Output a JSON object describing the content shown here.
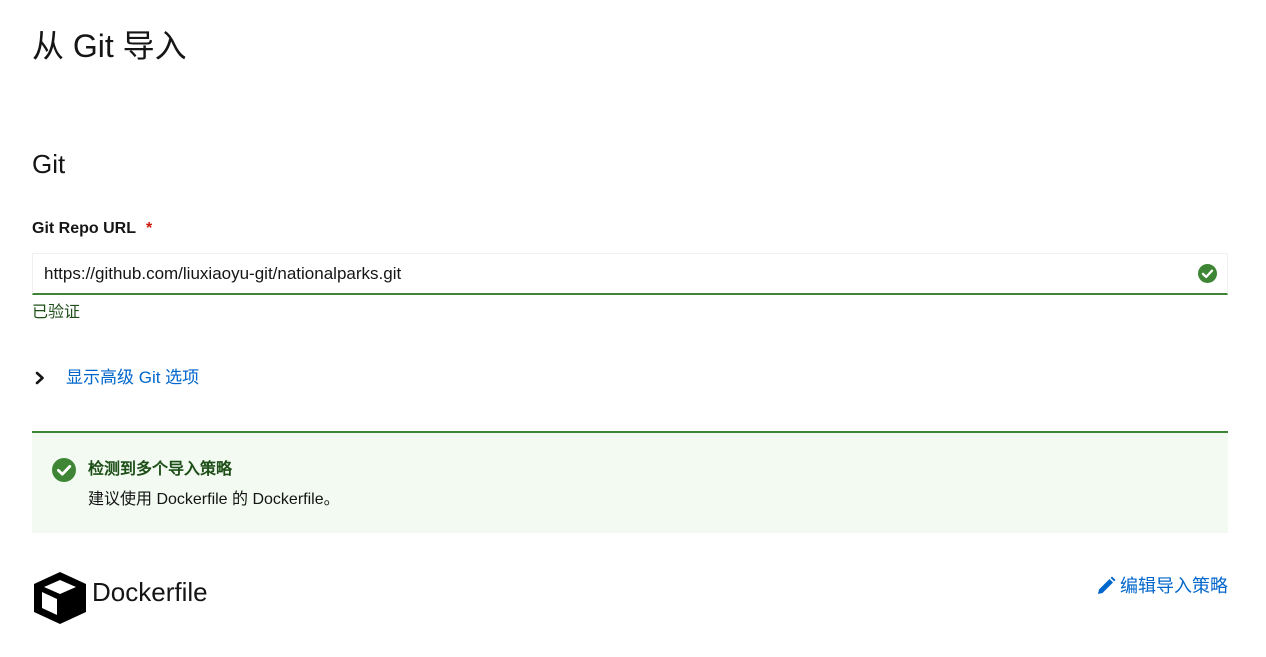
{
  "page": {
    "title": "从 Git 导入"
  },
  "git_section": {
    "title": "Git",
    "repo_url": {
      "label": "Git Repo URL",
      "required_marker": "*",
      "value": "https://github.com/liuxiaoyu-git/nationalparks.git",
      "helper_text": "已验证",
      "status_icon": "check-circle-icon"
    },
    "advanced_toggle": {
      "label": "显示高级 Git 选项",
      "icon": "chevron-right-icon"
    }
  },
  "alert": {
    "title": "检测到多个导入策略",
    "description": "建议使用 Dockerfile 的 Dockerfile。",
    "icon": "check-circle-icon"
  },
  "strategy": {
    "name": "Dockerfile",
    "icon": "docker-box-icon",
    "edit_label": "编辑导入策略",
    "edit_icon": "pencil-icon"
  },
  "colors": {
    "success": "#3e8635",
    "success_text": "#1e4f18",
    "link": "#0066cc",
    "required": "#c9190b",
    "alert_bg": "#f3faf2"
  }
}
